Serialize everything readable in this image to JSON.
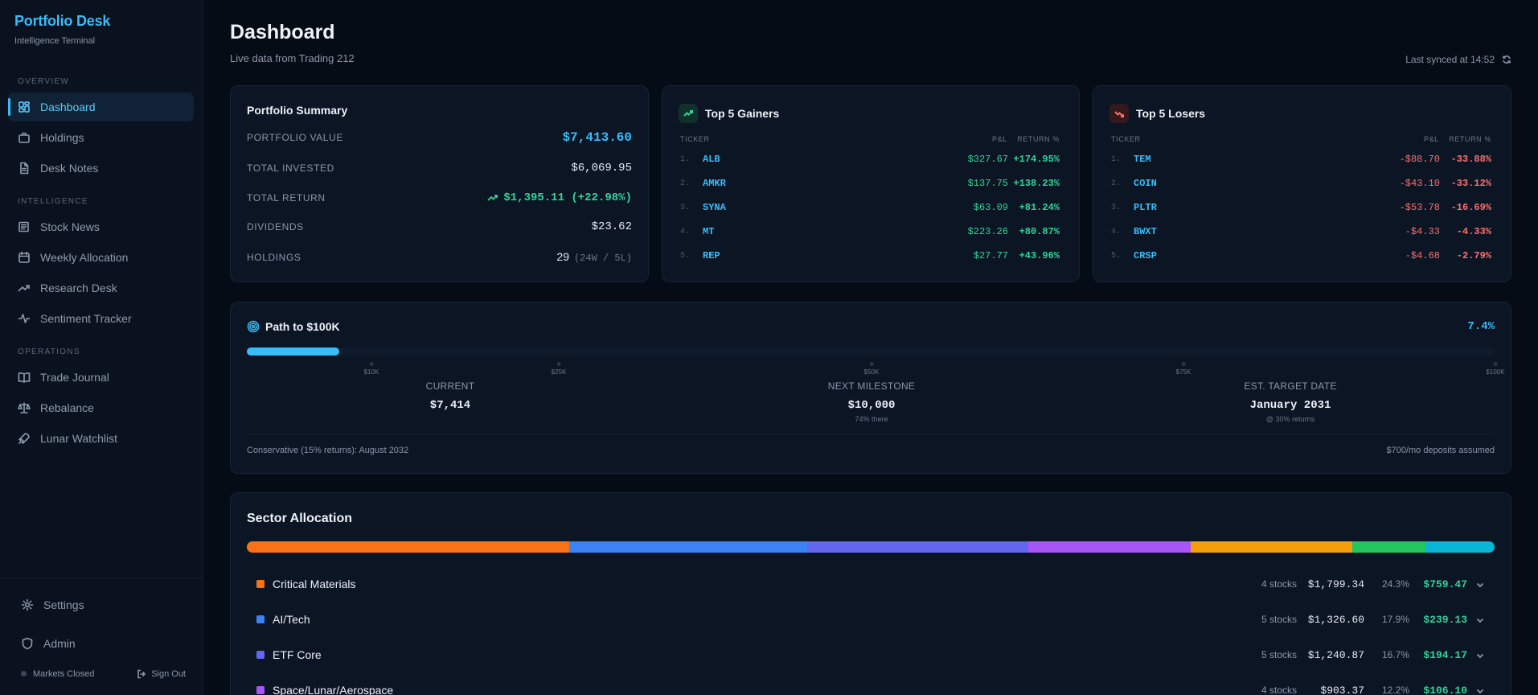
{
  "app": {
    "title": "Portfolio Desk",
    "subtitle": "Intelligence Terminal"
  },
  "sidebar": {
    "sections": [
      "OVERVIEW",
      "INTELLIGENCE",
      "OPERATIONS"
    ],
    "items": [
      {
        "label": "Dashboard",
        "icon": "dashboard-icon",
        "active": true
      },
      {
        "label": "Holdings",
        "icon": "briefcase-icon"
      },
      {
        "label": "Desk Notes",
        "icon": "document-icon"
      },
      {
        "label": "Stock News",
        "icon": "newspaper-icon"
      },
      {
        "label": "Weekly Allocation",
        "icon": "calendar-icon"
      },
      {
        "label": "Research Desk",
        "icon": "trending-up-icon"
      },
      {
        "label": "Sentiment Tracker",
        "icon": "activity-icon"
      },
      {
        "label": "Trade Journal",
        "icon": "book-icon"
      },
      {
        "label": "Rebalance",
        "icon": "scale-icon"
      },
      {
        "label": "Lunar Watchlist",
        "icon": "rocket-icon"
      }
    ],
    "settings": "Settings",
    "admin": "Admin",
    "market_status": "Markets Closed",
    "sign_out": "Sign Out"
  },
  "header": {
    "title": "Dashboard",
    "subtitle": "Live data from Trading 212",
    "synced": "Last synced at 14:52"
  },
  "summary": {
    "title": "Portfolio Summary",
    "portfolio_value_label": "PORTFOLIO VALUE",
    "portfolio_value": "$7,413.60",
    "total_invested_label": "TOTAL INVESTED",
    "total_invested": "$6,069.95",
    "total_return_label": "TOTAL RETURN",
    "total_return": "$1,395.11 (+22.98%)",
    "dividends_label": "DIVIDENDS",
    "dividends": "$23.62",
    "holdings_label": "HOLDINGS",
    "holdings": "29",
    "holdings_detail": "(24W / 5L)"
  },
  "gainers": {
    "title": "Top 5 Gainers",
    "col_ticker": "TICKER",
    "col_pl": "P&L",
    "col_return": "RETURN %",
    "rows": [
      {
        "idx": "1.",
        "ticker": "ALB",
        "pl": "$327.67",
        "ret": "+174.95%"
      },
      {
        "idx": "2.",
        "ticker": "AMKR",
        "pl": "$137.75",
        "ret": "+138.23%"
      },
      {
        "idx": "3.",
        "ticker": "SYNA",
        "pl": "$63.09",
        "ret": "+81.24%"
      },
      {
        "idx": "4.",
        "ticker": "MT",
        "pl": "$223.26",
        "ret": "+80.87%"
      },
      {
        "idx": "5.",
        "ticker": "REP",
        "pl": "$27.77",
        "ret": "+43.96%"
      }
    ]
  },
  "losers": {
    "title": "Top 5 Losers",
    "col_ticker": "TICKER",
    "col_pl": "P&L",
    "col_return": "RETURN %",
    "rows": [
      {
        "idx": "1.",
        "ticker": "TEM",
        "pl": "-$88.70",
        "ret": "-33.88%"
      },
      {
        "idx": "2.",
        "ticker": "COIN",
        "pl": "-$43.10",
        "ret": "-33.12%"
      },
      {
        "idx": "3.",
        "ticker": "PLTR",
        "pl": "-$53.78",
        "ret": "-16.69%"
      },
      {
        "idx": "4.",
        "ticker": "BWXT",
        "pl": "-$4.33",
        "ret": "-4.33%"
      },
      {
        "idx": "5.",
        "ticker": "CRSP",
        "pl": "-$4.68",
        "ret": "-2.79%"
      }
    ]
  },
  "path": {
    "title": "Path to $100K",
    "pct": "7.4%",
    "progress": 0.074,
    "ticks": [
      "$10K",
      "$25K",
      "$50K",
      "$75K",
      "$100K"
    ],
    "current_label": "CURRENT",
    "current": "$7,414",
    "milestone_label": "NEXT MILESTONE",
    "milestone": "$10,000",
    "milestone_sub": "74% there",
    "target_label": "EST. TARGET DATE",
    "target": "January 2031",
    "target_sub": "@ 30% returns",
    "foot_left": "Conservative (15% returns): August 2032",
    "foot_right": "$700/mo deposits assumed"
  },
  "sectors": {
    "title": "Sector Allocation",
    "rows": [
      {
        "name": "Critical Materials",
        "color": "#f97316",
        "stocks": "4 stocks",
        "value": "$1,799.34",
        "pct": "24.3%",
        "gain": "$759.47"
      },
      {
        "name": "AI/Tech",
        "color": "#3b82f6",
        "stocks": "5 stocks",
        "value": "$1,326.60",
        "pct": "17.9%",
        "gain": "$239.13"
      },
      {
        "name": "ETF Core",
        "color": "#6366f1",
        "stocks": "5 stocks",
        "value": "$1,240.87",
        "pct": "16.7%",
        "gain": "$194.17"
      },
      {
        "name": "Space/Lunar/Aerospace",
        "color": "#a855f7",
        "stocks": "4 stocks",
        "value": "$903.37",
        "pct": "12.2%",
        "gain": "$106.10"
      }
    ],
    "bar_segments": [
      {
        "color": "#f97316",
        "share": 24.3
      },
      {
        "color": "#3b82f6",
        "share": 17.9
      },
      {
        "color": "#6366f1",
        "share": 16.7
      },
      {
        "color": "#a855f7",
        "share": 12.2
      },
      {
        "color": "#f59e0b",
        "share": 12.2
      },
      {
        "color": "#22c55e",
        "share": 5.5
      },
      {
        "color": "#06b6d4",
        "share": 5.2
      }
    ]
  }
}
